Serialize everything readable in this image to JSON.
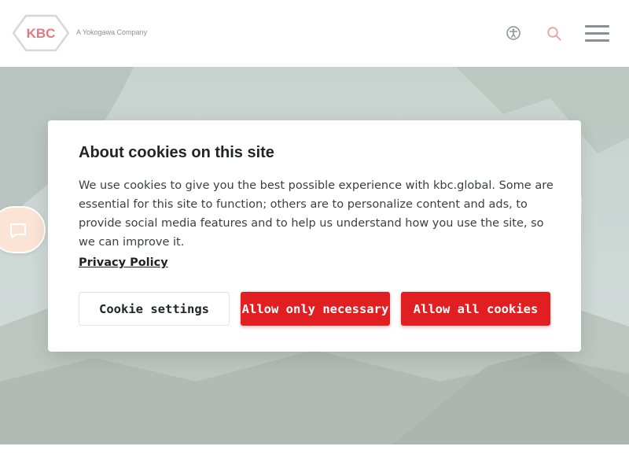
{
  "header": {
    "logo_text": "KBC",
    "logo_tagline": "A Yokogawa Company",
    "icons": [
      "accessibility-icon",
      "search-icon",
      "hamburger-menu-icon"
    ]
  },
  "chat": {
    "icon": "chat-bubble-icon"
  },
  "cookie_modal": {
    "title": "About cookies on this site",
    "body": "We use cookies to give you the best possible experience with kbc.global. Some are essential for this site to function; others are to personalize content and ads, to provide social media features and to help us understand how you use the site, so we can improve it.",
    "privacy_link": "Privacy Policy",
    "buttons": {
      "settings": "Cookie settings",
      "necessary": "Allow only necessary",
      "all": "Allow all cookies"
    }
  },
  "colors": {
    "accent_red": "#e11f22",
    "logo_red": "#e07a80",
    "chat_bg": "#fbe3d6",
    "icon_gray": "#8b8e93"
  }
}
